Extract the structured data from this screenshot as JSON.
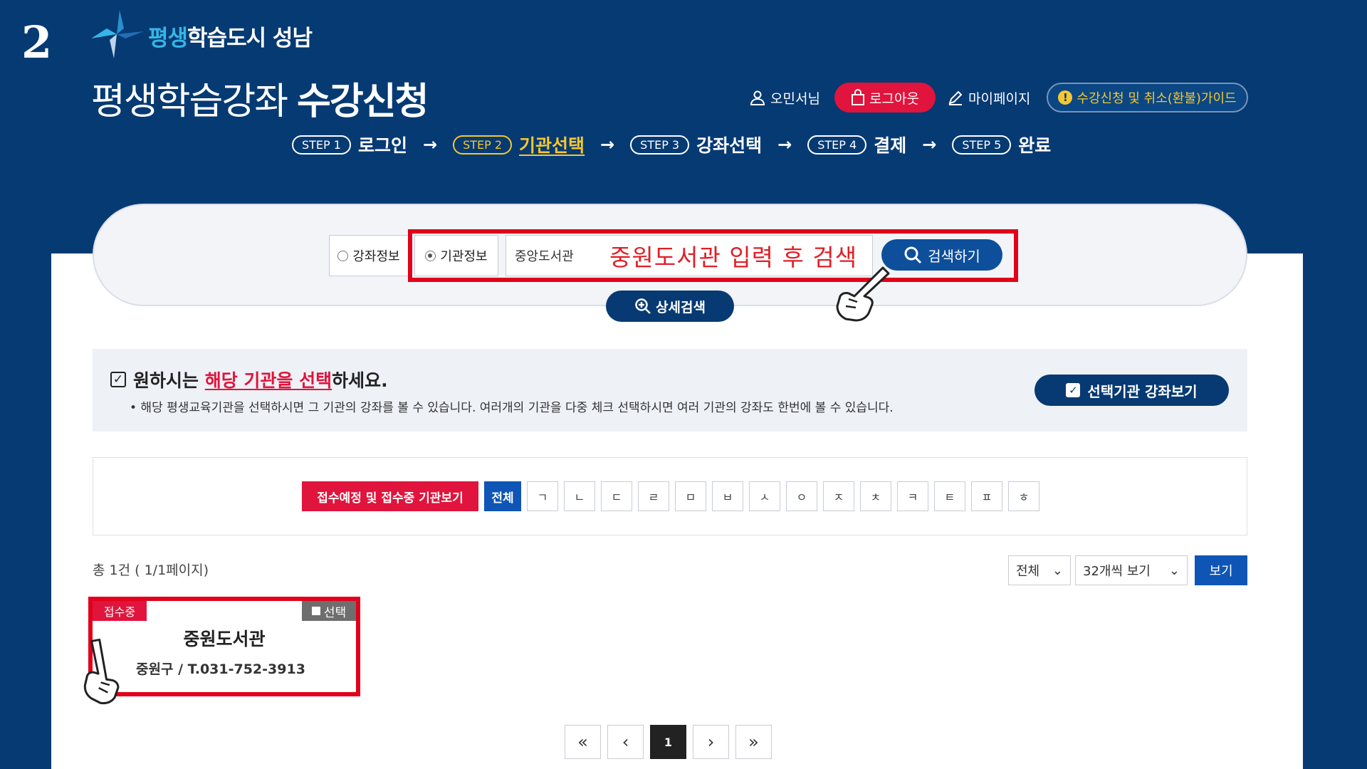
{
  "slide_number": "2",
  "logo": {
    "highlight": "평생",
    "rest": "학습도시 성남"
  },
  "title": {
    "light": "평생학습강좌",
    "bold": "수강신청"
  },
  "util": {
    "user": "오민서님",
    "logout": "로그아웃",
    "mypage": "마이페이지",
    "guide": "수강신청 및 취소(환불)가이드"
  },
  "steps": [
    {
      "pill": "STEP 1",
      "label": "로그인"
    },
    {
      "pill": "STEP 2",
      "label": "기관선택"
    },
    {
      "pill": "STEP 3",
      "label": "강좌선택"
    },
    {
      "pill": "STEP 4",
      "label": "결제"
    },
    {
      "pill": "STEP 5",
      "label": "완료"
    }
  ],
  "step_arrow": "→",
  "search": {
    "option_course": "강좌정보",
    "option_org": "기관정보",
    "input_value": "중앙도서관",
    "hint": "중원도서관 입력 후 검색",
    "button": "검색하기",
    "detail_button": "상세검색"
  },
  "info": {
    "title_prefix": "원하시는 ",
    "title_highlight": "해당 기관을 선택",
    "title_suffix": "하세요.",
    "desc": "• 해당 평생교육기관을 선택하시면 그 기관의 강좌를 볼 수 있습니다. 여러개의 기관을 다중 체크 선택하시면 여러 기관의 강좌도 한번에 볼 수 있습니다.",
    "view_selected": "선택기관 강좌보기"
  },
  "filter": {
    "receiving": "접수예정 및 접수중 기관보기",
    "all": "전체",
    "consonants": [
      "ㄱ",
      "ㄴ",
      "ㄷ",
      "ㄹ",
      "ㅁ",
      "ㅂ",
      "ㅅ",
      "ㅇ",
      "ㅈ",
      "ㅊ",
      "ㅋ",
      "ㅌ",
      "ㅍ",
      "ㅎ"
    ]
  },
  "results": {
    "total": "총 1건 ( 1/1페이지)",
    "type_select": "전체",
    "count_select": "32개씩 보기",
    "view_button": "보기"
  },
  "card": {
    "status": "접수중",
    "select": "선택",
    "name": "중원도서관",
    "info": "중원구 / T.031-752-3913"
  },
  "pagination": {
    "first": "«",
    "prev": "‹",
    "current": "1",
    "next": "›",
    "last": "»"
  },
  "colors": {
    "navy": "#063a73",
    "red": "#e0143c",
    "blue": "#0e55b6",
    "yellow": "#f6c72f"
  }
}
